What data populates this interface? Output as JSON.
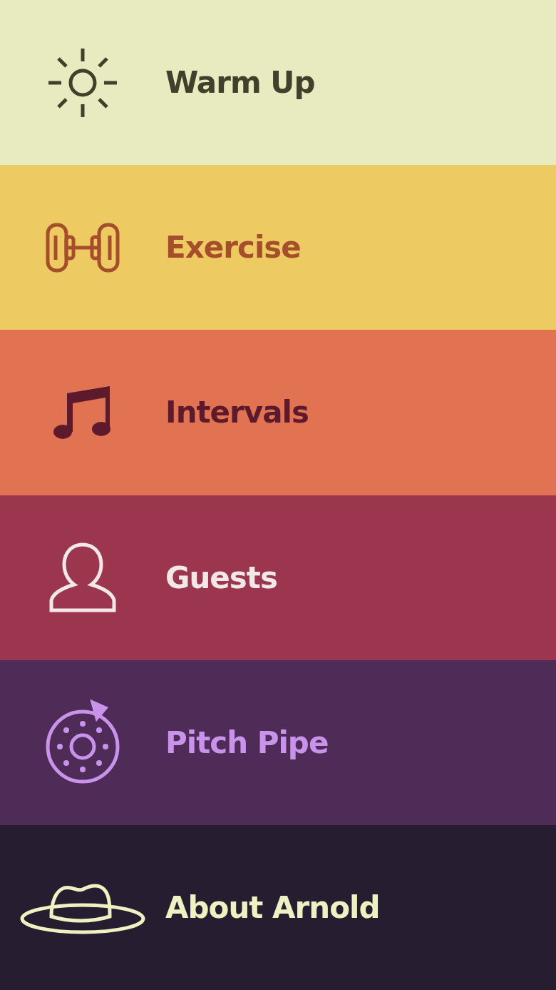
{
  "menu": {
    "items": [
      {
        "label": "Warm Up",
        "kind": "sun",
        "color": "#e8ebbf"
      },
      {
        "label": "Exercise",
        "kind": "dumbbell",
        "color": "#eeca62"
      },
      {
        "label": "Intervals",
        "kind": "note",
        "color": "#e17352"
      },
      {
        "label": "Guests",
        "kind": "person",
        "color": "#9c364f"
      },
      {
        "label": "Pitch Pipe",
        "kind": "pipe",
        "color": "#4f2c57"
      },
      {
        "label": "About Arnold",
        "kind": "hat",
        "color": "#261e30"
      }
    ]
  }
}
